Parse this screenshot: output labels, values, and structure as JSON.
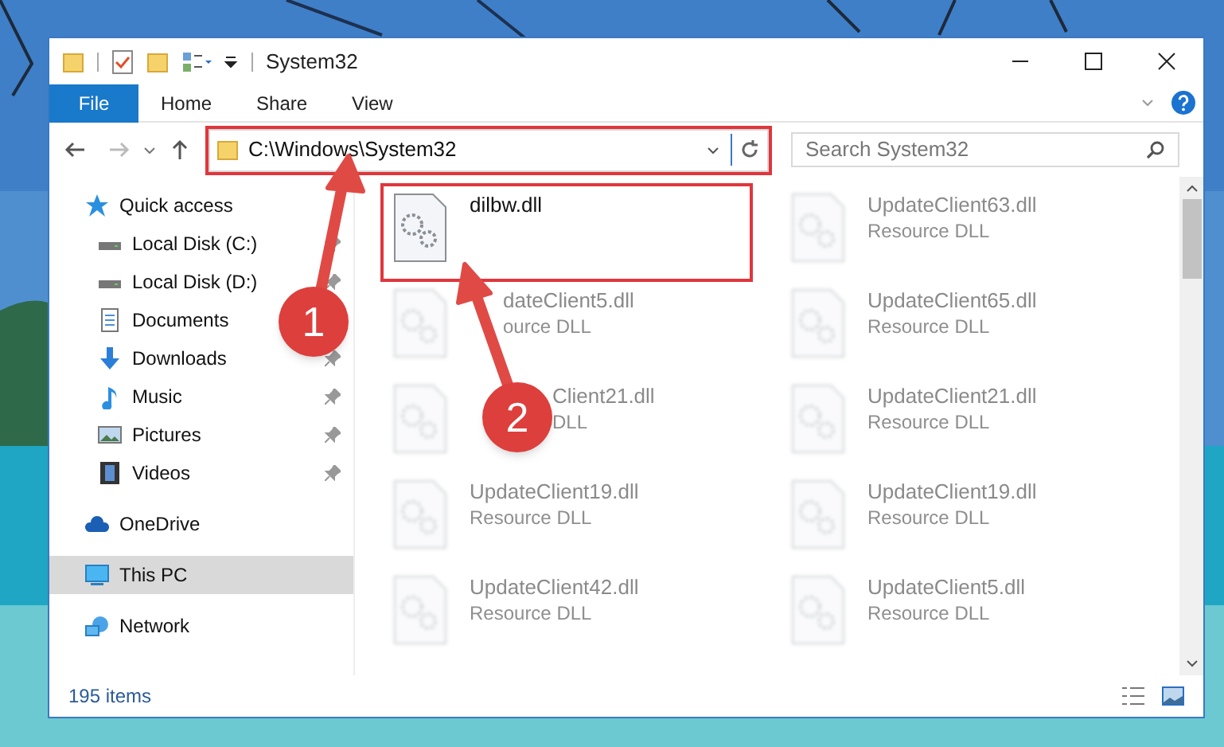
{
  "window": {
    "title": "System32"
  },
  "ribbon": {
    "tabs": [
      {
        "label": "File",
        "selected": true
      },
      {
        "label": "Home",
        "selected": false
      },
      {
        "label": "Share",
        "selected": false
      },
      {
        "label": "View",
        "selected": false
      }
    ]
  },
  "address": {
    "path": "C:\\Windows\\System32"
  },
  "search": {
    "placeholder": "Search System32"
  },
  "sidebar": {
    "items": [
      {
        "label": "Quick access",
        "kind": "star",
        "selected": false,
        "children": [
          {
            "label": "Local Disk (C:)",
            "kind": "drive",
            "pinned": true
          },
          {
            "label": "Local Disk (D:)",
            "kind": "drive",
            "pinned": true
          },
          {
            "label": "Documents",
            "kind": "document"
          },
          {
            "label": "Downloads",
            "kind": "download",
            "pinned": true
          },
          {
            "label": "Music",
            "kind": "music",
            "pinned": true
          },
          {
            "label": "Pictures",
            "kind": "pictures",
            "pinned": true
          },
          {
            "label": "Videos",
            "kind": "videos",
            "pinned": true
          }
        ]
      },
      {
        "label": "OneDrive",
        "kind": "cloud",
        "selected": false
      },
      {
        "label": "This PC",
        "kind": "pc",
        "selected": true
      },
      {
        "label": "Network",
        "kind": "network",
        "selected": false
      }
    ]
  },
  "files": [
    {
      "name": "dilbw.dll",
      "blurred": false,
      "highlighted": true
    },
    {
      "name": "UpdateClient63.dll",
      "type": "Resource DLL",
      "blurred": true
    },
    {
      "name": "dateClient5.dll",
      "type": "ource DLL",
      "blurred": true,
      "kind": "arrowed"
    },
    {
      "name": "UpdateClient65.dll",
      "type": "Resource DLL",
      "blurred": true
    },
    {
      "name": "Client21.dll",
      "type": "DLL",
      "blurred": true,
      "kind": "badged"
    },
    {
      "name": "UpdateClient21.dll",
      "type": "Resource DLL",
      "blurred": true
    },
    {
      "name": "UpdateClient19.dll",
      "type": "Resource DLL",
      "blurred": true
    },
    {
      "name": "UpdateClient19.dll",
      "type": "Resource DLL",
      "blurred": true
    },
    {
      "name": "UpdateClient42.dll",
      "type": "Resource DLL",
      "blurred": true
    },
    {
      "name": "UpdateClient5.dll",
      "type": "Resource DLL",
      "blurred": true
    }
  ],
  "status_bar": {
    "count": "195 items"
  },
  "annotations": [
    {
      "number": "1"
    },
    {
      "number": "2"
    }
  ]
}
